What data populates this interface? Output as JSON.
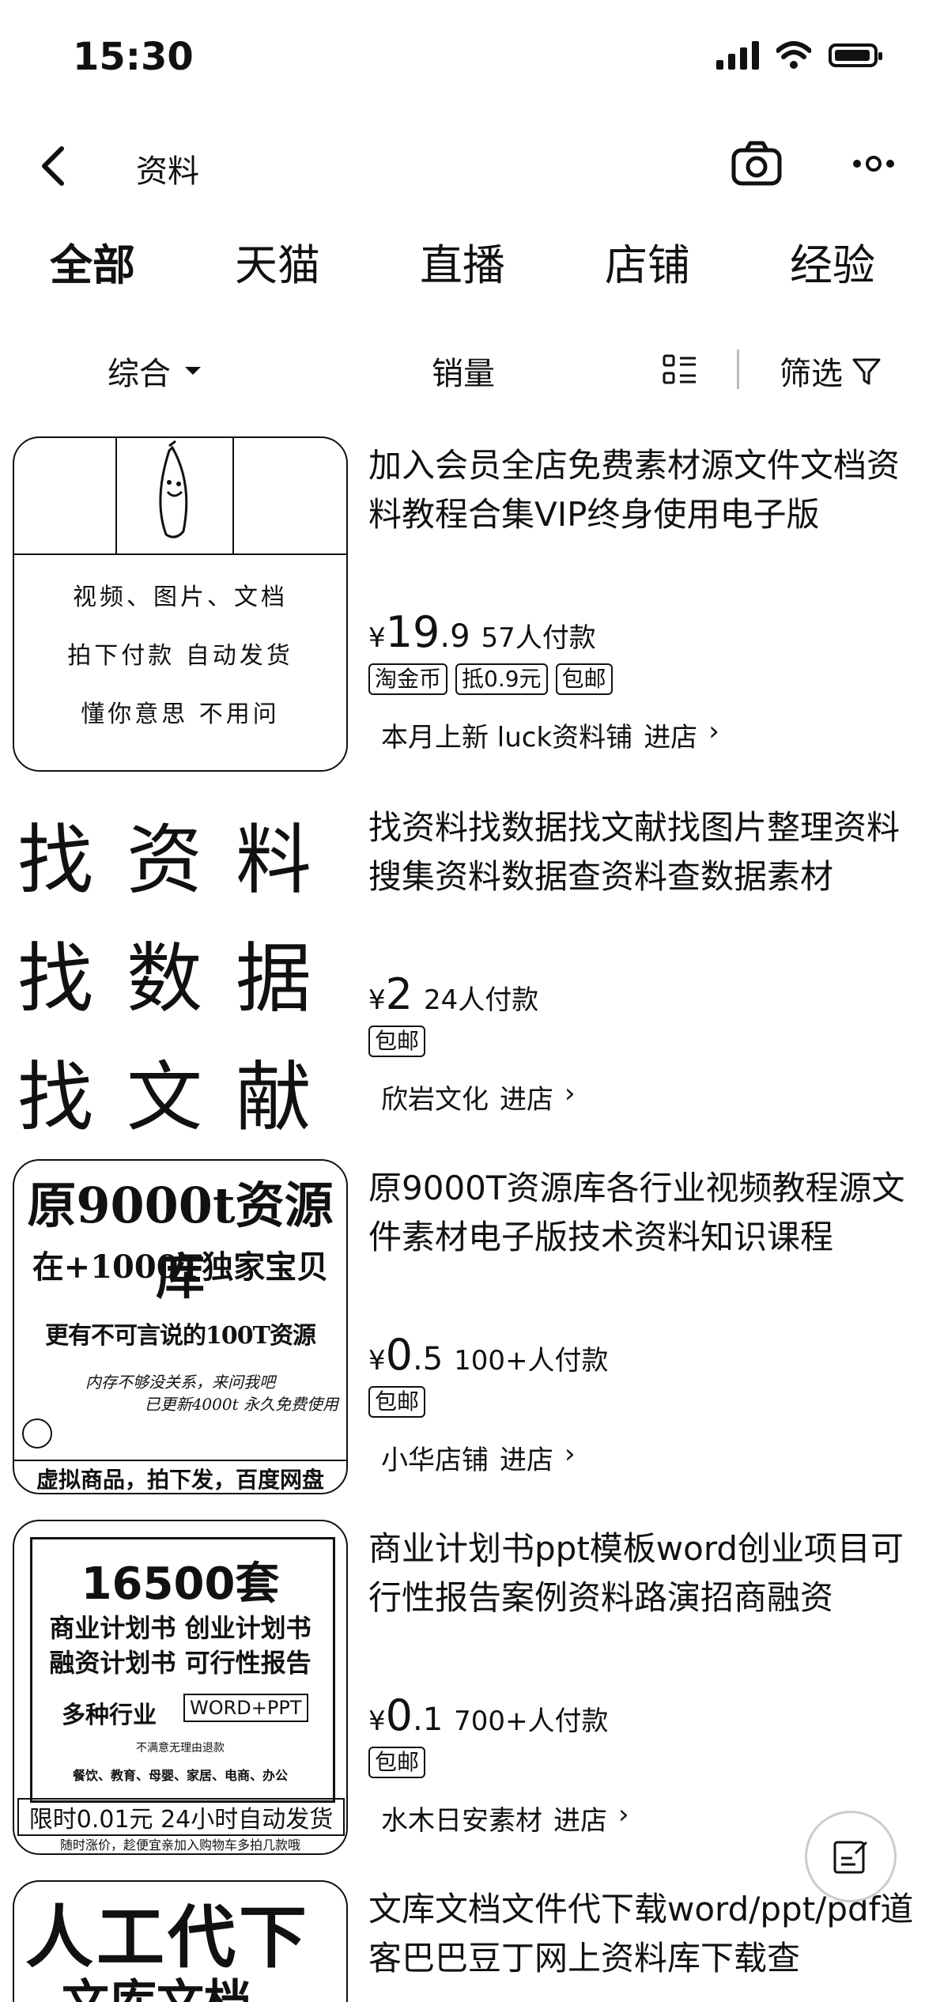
{
  "status_bar": {
    "time": "15:30"
  },
  "nav": {
    "title": "资料"
  },
  "tabs": [
    {
      "label": "全部",
      "active": true
    },
    {
      "label": "天猫"
    },
    {
      "label": "直播"
    },
    {
      "label": "店铺"
    },
    {
      "label": "经验"
    }
  ],
  "filters": {
    "sort": "综合",
    "sales": "销量",
    "filter": "筛选"
  },
  "products": [
    {
      "title": "加入会员全店免费素材源文件文档资料教程合集VIP终身使用电子版",
      "currency": "¥",
      "price_int": "19",
      "price_dec": ".9",
      "sold": "57人付款",
      "tags": [
        "淘金币",
        "抵0.9元",
        "包邮"
      ],
      "shop": "本月上新 luck资料铺",
      "enter": "进店",
      "thumb_lines": [
        "视频、图片、文档",
        "拍下付款 自动发货",
        "懂你意思 不用问"
      ]
    },
    {
      "title": "找资料找数据找文献找图片整理资料搜集资料数据查资料查数据素材",
      "currency": "¥",
      "price_int": "2",
      "price_dec": "",
      "sold": "24人付款",
      "tags": [
        "包邮"
      ],
      "shop": "欣岩文化",
      "enter": "进店",
      "thumb_lines": [
        "找资料",
        "找数据",
        "找文献"
      ]
    },
    {
      "title": "原9000T资源库各行业视频教程源文件素材电子版技术资料知识课程",
      "currency": "¥",
      "price_int": "0",
      "price_dec": ".5",
      "sold": "100+人付款",
      "tags": [
        "包邮"
      ],
      "shop": "小华店铺",
      "enter": "进店",
      "thumb_lines": [
        "原9000t资源库",
        "在+1000T独家宝贝",
        "更有不可言说的100T资源",
        "内存不够没关系，来问我吧",
        "已更新4000t 永久免费使用",
        "虚拟商品，拍下发，百度网盘"
      ]
    },
    {
      "title": "商业计划书ppt模板word创业项目可行性报告案例资料路演招商融资",
      "currency": "¥",
      "price_int": "0",
      "price_dec": ".1",
      "sold": "700+人付款",
      "tags": [
        "包邮"
      ],
      "shop": "水木日安素材",
      "enter": "进店",
      "thumb_lines": [
        "16500套",
        "商业计划书 创业计划书",
        "融资计划书 可行性报告",
        "多种行业",
        "WORD+PPT",
        "不满意无理由退款",
        "餐饮、教育、母婴、家居、电商、办公",
        "限时0.01元 24小时自动发货",
        "随时涨价，趁便宜亲加入购物车多拍几款哦"
      ]
    },
    {
      "title": "文库文档文件代下载word/ppt/pdf道客巴巴豆丁网上资料库下载查",
      "thumb_lines": [
        "人工代下",
        "文库文档"
      ]
    }
  ]
}
